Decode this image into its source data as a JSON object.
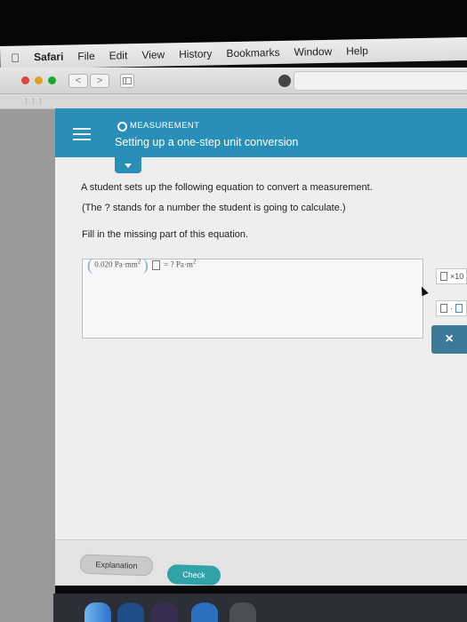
{
  "menubar": {
    "app": "Safari",
    "items": [
      "File",
      "Edit",
      "View",
      "History",
      "Bookmarks",
      "Window",
      "Help"
    ]
  },
  "toolbar": {
    "back": "<",
    "forward": ">"
  },
  "header": {
    "topic": "MEASUREMENT",
    "title": "Setting up a one-step unit conversion"
  },
  "question": {
    "line1": "A student sets up the following equation to convert a measurement.",
    "line2": "(The ? stands for a number the student is going to calculate.)",
    "line3": "Fill in the missing part of this equation."
  },
  "equation": {
    "value": "0.020",
    "unit": "Pa·mm",
    "exp": "2",
    "equals": "= ?",
    "result_unit": "Pa·m",
    "result_exp": "2"
  },
  "tools": {
    "sci": "×10",
    "dot": "·"
  },
  "buttons": {
    "close": "×",
    "explanation": "Explanation",
    "check": "Check"
  },
  "colors": {
    "header": "#2a8fb8",
    "check": "#2fa3a8",
    "close": "#3b7a96"
  }
}
